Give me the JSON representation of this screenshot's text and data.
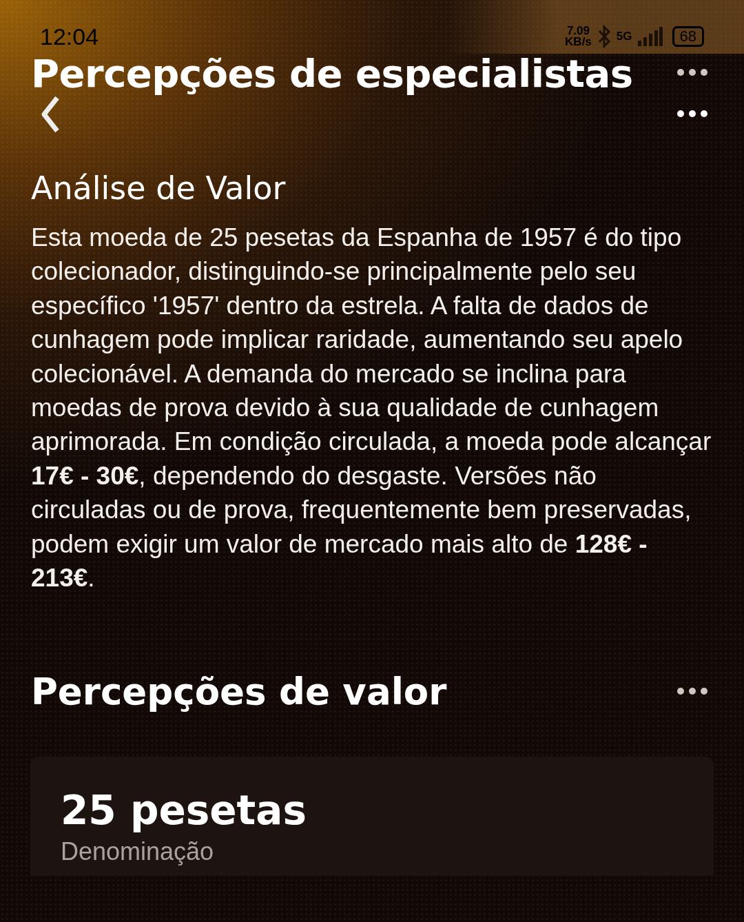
{
  "status_bar": {
    "time": "12:04",
    "speed_value": "7.09",
    "speed_unit": "KB/s",
    "network": "5G",
    "battery": "68"
  },
  "header": {
    "title": "Percepções de especialistas"
  },
  "analysis": {
    "heading": "Análise de Valor",
    "text": "Esta moeda de 25 pesetas da Espanha de 1957 é do tipo colecionador, distinguindo-se principalmente pelo seu específico '1957' dentro da estrela. A falta de dados de cunhagem pode implicar raridade, aumentando seu apelo colecionável. A demanda do mercado se inclina para moedas de prova devido à sua qualidade de cunhagem aprimorada. Em condição circulada, a moeda pode alcançar **17€ - 30€**, dependendo do desgaste. Versões não circuladas ou de prova, frequentemente bem preservadas, podem exigir um valor de mercado mais alto de **128€ - 213€**."
  },
  "value_section": {
    "heading": "Percepções de valor",
    "card": {
      "value": "25 pesetas",
      "label": "Denominação"
    }
  }
}
